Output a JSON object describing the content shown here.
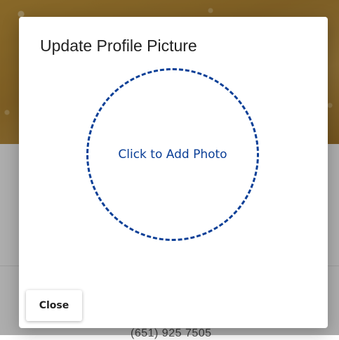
{
  "background": {
    "phone_partial": "(651) 925 7505"
  },
  "modal": {
    "title": "Update Profile Picture",
    "photo_drop_label": "Click to Add Photo",
    "close_label": "Close"
  },
  "colors": {
    "accent": "#0b3f97",
    "overlay": "rgba(0,0,0,0.32)"
  }
}
